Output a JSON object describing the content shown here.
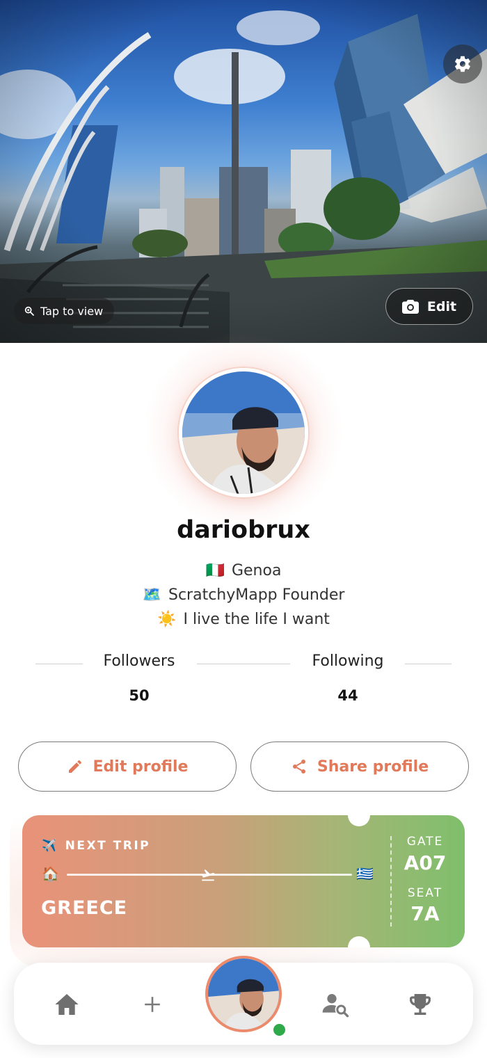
{
  "cover": {
    "tap_label": "Tap to view",
    "edit_label": "Edit",
    "icons": [
      "gear-icon",
      "search-icon",
      "camera-icon"
    ]
  },
  "profile": {
    "username": "dariobrux",
    "bio": [
      {
        "emoji": "🇮🇹",
        "text": "Genoa"
      },
      {
        "emoji": "🗺️",
        "text": "ScratchyMapp Founder"
      },
      {
        "emoji": "☀️",
        "text": "I live the life I want"
      }
    ]
  },
  "stats": {
    "followers_label": "Followers",
    "followers_value": "50",
    "following_label": "Following",
    "following_value": "44"
  },
  "actions": {
    "edit_profile": "Edit profile",
    "share_profile": "Share profile",
    "accent": "#e07a5a"
  },
  "trip": {
    "label": "NEXT TRIP",
    "label_emoji": "✈️",
    "origin_emoji": "🏠",
    "destination_emoji": "🇬🇷",
    "destination": "GREECE",
    "gate_label": "GATE",
    "gate_value": "A07",
    "seat_label": "SEAT",
    "seat_value": "7A",
    "gradient": [
      "#e99279",
      "#7fbf6c"
    ]
  },
  "nav": {
    "items": [
      "home-icon",
      "plus-icon",
      "profile-avatar",
      "user-search-icon",
      "trophy-icon"
    ],
    "online_color": "#2eaa4a",
    "avatar_ring": "#ec8a6c"
  }
}
